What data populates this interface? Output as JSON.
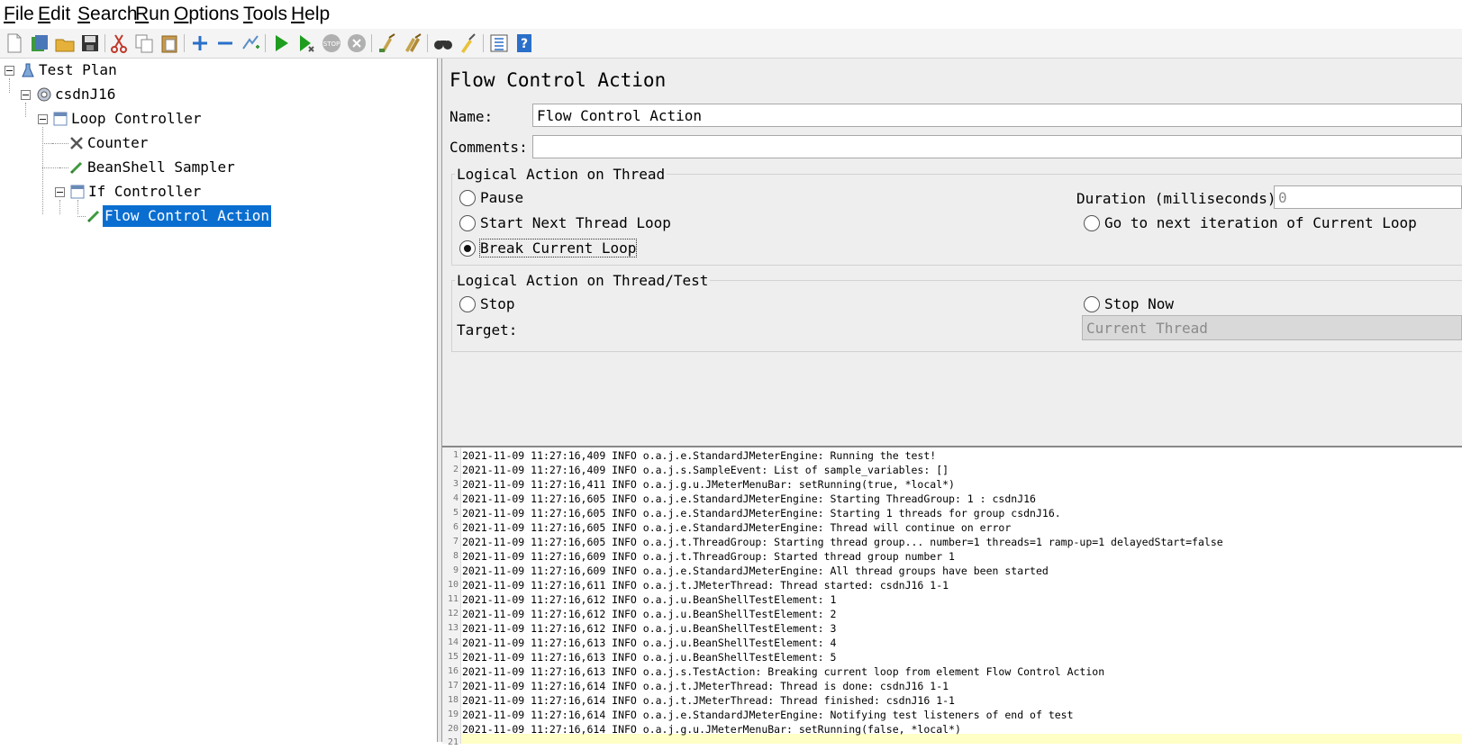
{
  "menu": {
    "items": [
      {
        "mnemonic": "F",
        "rest": "ile"
      },
      {
        "mnemonic": "E",
        "rest": "dit"
      },
      {
        "mnemonic": "S",
        "rest": "earch"
      },
      {
        "mnemonic": "R",
        "rest": "un"
      },
      {
        "mnemonic": "O",
        "rest": "ptions"
      },
      {
        "mnemonic": "T",
        "rest": "ools"
      },
      {
        "mnemonic": "H",
        "rest": "elp"
      }
    ]
  },
  "toolbar": {
    "icons": [
      "new-icon",
      "templates-icon",
      "open-icon",
      "save-icon",
      "cut-icon",
      "copy-icon",
      "paste-icon",
      "expand-icon",
      "collapse-icon",
      "toggle-icon",
      "start-icon",
      "start-no-pause-icon",
      "stop-icon",
      "shutdown-icon",
      "clear-icon",
      "clear-all-icon",
      "search-icon",
      "reset-search-icon",
      "function-helper-icon",
      "help-icon"
    ]
  },
  "tree": {
    "nodes": [
      {
        "label": "Test Plan",
        "icon": "test-plan-icon"
      },
      {
        "label": "csdnJ16",
        "icon": "thread-group-icon"
      },
      {
        "label": "Loop Controller",
        "icon": "loop-controller-icon"
      },
      {
        "label": "Counter",
        "icon": "counter-icon"
      },
      {
        "label": "BeanShell Sampler",
        "icon": "sampler-icon"
      },
      {
        "label": "If Controller",
        "icon": "if-controller-icon"
      },
      {
        "label": "Flow Control Action",
        "icon": "flow-action-icon",
        "selected": true
      }
    ]
  },
  "panel": {
    "title": "Flow Control Action",
    "name_label": "Name:",
    "name_value": "Flow Control Action",
    "comments_label": "Comments:",
    "comments_value": "",
    "thread_group": {
      "title": "Logical Action on Thread",
      "pause": "Pause",
      "start_next": "Start Next Thread Loop",
      "break_loop": "Break Current Loop",
      "duration_label": "Duration (milliseconds):",
      "duration_value": "0",
      "go_next": "Go to next iteration of Current Loop",
      "selected": "break_loop"
    },
    "test_group": {
      "title": "Logical Action on Thread/Test",
      "stop": "Stop",
      "stop_now": "Stop Now",
      "target_label": "Target:",
      "target_value": "Current Thread"
    }
  },
  "log": {
    "lines": [
      "2021-11-09 11:27:16,409 INFO o.a.j.e.StandardJMeterEngine: Running the test!",
      "2021-11-09 11:27:16,409 INFO o.a.j.s.SampleEvent: List of sample_variables: []",
      "2021-11-09 11:27:16,411 INFO o.a.j.g.u.JMeterMenuBar: setRunning(true, *local*)",
      "2021-11-09 11:27:16,605 INFO o.a.j.e.StandardJMeterEngine: Starting ThreadGroup: 1 : csdnJ16",
      "2021-11-09 11:27:16,605 INFO o.a.j.e.StandardJMeterEngine: Starting 1 threads for group csdnJ16.",
      "2021-11-09 11:27:16,605 INFO o.a.j.e.StandardJMeterEngine: Thread will continue on error",
      "2021-11-09 11:27:16,605 INFO o.a.j.t.ThreadGroup: Starting thread group... number=1 threads=1 ramp-up=1 delayedStart=false",
      "2021-11-09 11:27:16,609 INFO o.a.j.t.ThreadGroup: Started thread group number 1",
      "2021-11-09 11:27:16,609 INFO o.a.j.e.StandardJMeterEngine: All thread groups have been started",
      "2021-11-09 11:27:16,611 INFO o.a.j.t.JMeterThread: Thread started: csdnJ16 1-1",
      "2021-11-09 11:27:16,612 INFO o.a.j.u.BeanShellTestElement: 1",
      "2021-11-09 11:27:16,612 INFO o.a.j.u.BeanShellTestElement: 2",
      "2021-11-09 11:27:16,612 INFO o.a.j.u.BeanShellTestElement: 3",
      "2021-11-09 11:27:16,613 INFO o.a.j.u.BeanShellTestElement: 4",
      "2021-11-09 11:27:16,613 INFO o.a.j.u.BeanShellTestElement: 5",
      "2021-11-09 11:27:16,613 INFO o.a.j.s.TestAction: Breaking current loop from element Flow Control Action",
      "2021-11-09 11:27:16,614 INFO o.a.j.t.JMeterThread: Thread is done: csdnJ16 1-1",
      "2021-11-09 11:27:16,614 INFO o.a.j.t.JMeterThread: Thread finished: csdnJ16 1-1",
      "2021-11-09 11:27:16,614 INFO o.a.j.e.StandardJMeterEngine: Notifying test listeners of end of test",
      "2021-11-09 11:27:16,614 INFO o.a.j.g.u.JMeterMenuBar: setRunning(false, *local*)"
    ],
    "numbers": [
      "1",
      "2",
      "3",
      "4",
      "5",
      "6",
      "7",
      "8",
      "9",
      "10",
      "11",
      "12",
      "13",
      "14",
      "15",
      "16",
      "17",
      "18",
      "19",
      "20",
      "21"
    ]
  }
}
